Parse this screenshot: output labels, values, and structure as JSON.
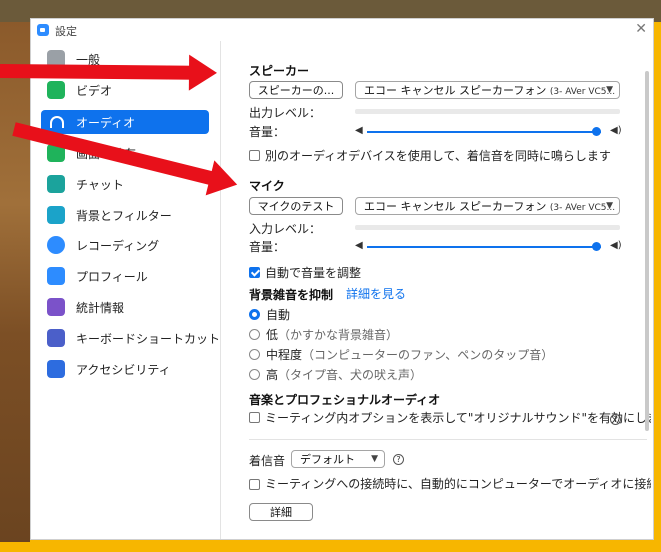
{
  "window": {
    "title": "設定"
  },
  "sidebar": {
    "items": [
      {
        "label": "一般",
        "icon": "gear-icon",
        "active": false
      },
      {
        "label": "ビデオ",
        "icon": "video-icon",
        "active": false
      },
      {
        "label": "オーディオ",
        "icon": "headphones-icon",
        "active": true
      },
      {
        "label": "画面の共有",
        "icon": "share-screen-icon",
        "active": false
      },
      {
        "label": "チャット",
        "icon": "chat-icon",
        "active": false
      },
      {
        "label": "背景とフィルター",
        "icon": "background-icon",
        "active": false
      },
      {
        "label": "レコーディング",
        "icon": "record-icon",
        "active": false
      },
      {
        "label": "プロフィール",
        "icon": "profile-icon",
        "active": false
      },
      {
        "label": "統計情報",
        "icon": "stats-icon",
        "active": false
      },
      {
        "label": "キーボードショートカット",
        "icon": "keyboard-icon",
        "active": false
      },
      {
        "label": "アクセシビリティ",
        "icon": "accessibility-icon",
        "active": false
      }
    ]
  },
  "speaker": {
    "title": "スピーカー",
    "test_button": "スピーカーの...",
    "device": "エコー キャンセル スピーカーフォン",
    "device_model": "(3- AVer VC5...",
    "output_level_label": "出力レベル：",
    "volume_label": "音量：",
    "volume_level": 0.98
  },
  "same_ring_checkbox": {
    "label": "別のオーディオデバイスを使用して、着信音を同時に鳴らします",
    "checked": false
  },
  "mic": {
    "title": "マイク",
    "test_button": "マイクのテスト",
    "device": "エコー キャンセル スピーカーフォン",
    "device_model": "(3- AVer VC5...",
    "input_level_label": "入力レベル：",
    "volume_label": "音量：",
    "volume_level": 0.98
  },
  "auto_adjust": {
    "label": "自動で音量を調整",
    "checked": true
  },
  "noise": {
    "title": "背景雑音を抑制",
    "learn_more": "詳細を見る",
    "options": [
      {
        "label": "自動",
        "hint": "",
        "checked": true
      },
      {
        "label": "低",
        "hint": "（かすかな背景雑音）",
        "checked": false
      },
      {
        "label": "中程度",
        "hint": "（コンピューターのファン、ペンのタップ音）",
        "checked": false
      },
      {
        "label": "高",
        "hint": "（タイプ音、犬の吠え声）",
        "checked": false
      }
    ]
  },
  "music": {
    "title": "音楽とプロフェショナルオーディオ",
    "original_sound_label": "ミーティング内オプションを表示して\"オリジナルサウンド\"を有効にします",
    "checked": false
  },
  "ringtone": {
    "label": "着信音",
    "value": "デフォルト"
  },
  "auto_join": {
    "label": "ミーティングへの接続時に、自動的にコンピューターでオーディオに接続",
    "checked": false
  },
  "advanced_button": "詳細",
  "colors": {
    "accent": "#0e72ed",
    "arrow": "#e8101a",
    "frame": "#f7b600"
  }
}
